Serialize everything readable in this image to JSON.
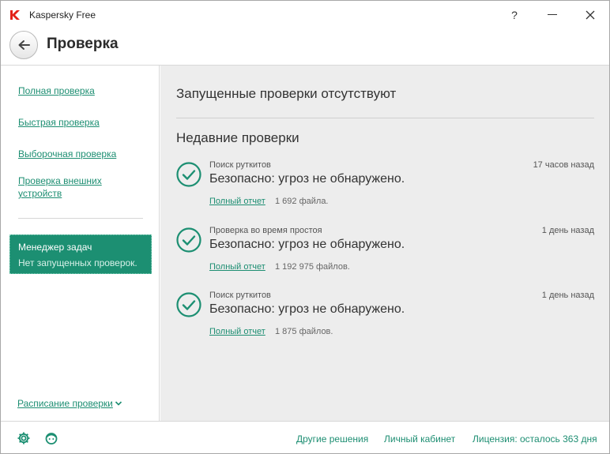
{
  "window": {
    "app_title": "Kaspersky Free",
    "help_label": "?",
    "minimize_label": "—",
    "close_label": "✕"
  },
  "header": {
    "title": "Проверка"
  },
  "sidebar": {
    "links": [
      {
        "label": "Полная проверка"
      },
      {
        "label": "Быстрая проверка"
      },
      {
        "label": "Выборочная проверка"
      },
      {
        "label": "Проверка внешних устройств"
      }
    ],
    "task_manager": {
      "title": "Менеджер задач",
      "subtitle": "Нет запущенных проверок."
    },
    "schedule_label": "Расписание проверки"
  },
  "main": {
    "status_heading": "Запущенные проверки отсутствуют",
    "recent_heading": "Недавние проверки",
    "scans": [
      {
        "type": "Поиск руткитов",
        "time": "17 часов назад",
        "result": "Безопасно: угроз не обнаружено.",
        "report_label": "Полный отчет",
        "files": "1 692 файла."
      },
      {
        "type": "Проверка во время простоя",
        "time": "1 день назад",
        "result": "Безопасно: угроз не обнаружено.",
        "report_label": "Полный отчет",
        "files": "1 192 975 файлов."
      },
      {
        "type": "Поиск руткитов",
        "time": "1 день назад",
        "result": "Безопасно: угроз не обнаружено.",
        "report_label": "Полный отчет",
        "files": "1 875 файлов."
      }
    ]
  },
  "footer": {
    "other_solutions": "Другие решения",
    "my_account": "Личный кабинет",
    "license": "Лицензия: осталось 363 дня"
  },
  "colors": {
    "accent": "#1c8f72",
    "main_bg": "#ededed",
    "logo_red": "#e32119"
  },
  "icons": {
    "app_logo": "kaspersky-k-logo",
    "back": "arrow-left-icon",
    "check": "check-circle-icon",
    "settings": "gear-icon",
    "support": "support-face-icon",
    "schedule_chevron": "chevron-down-icon"
  }
}
